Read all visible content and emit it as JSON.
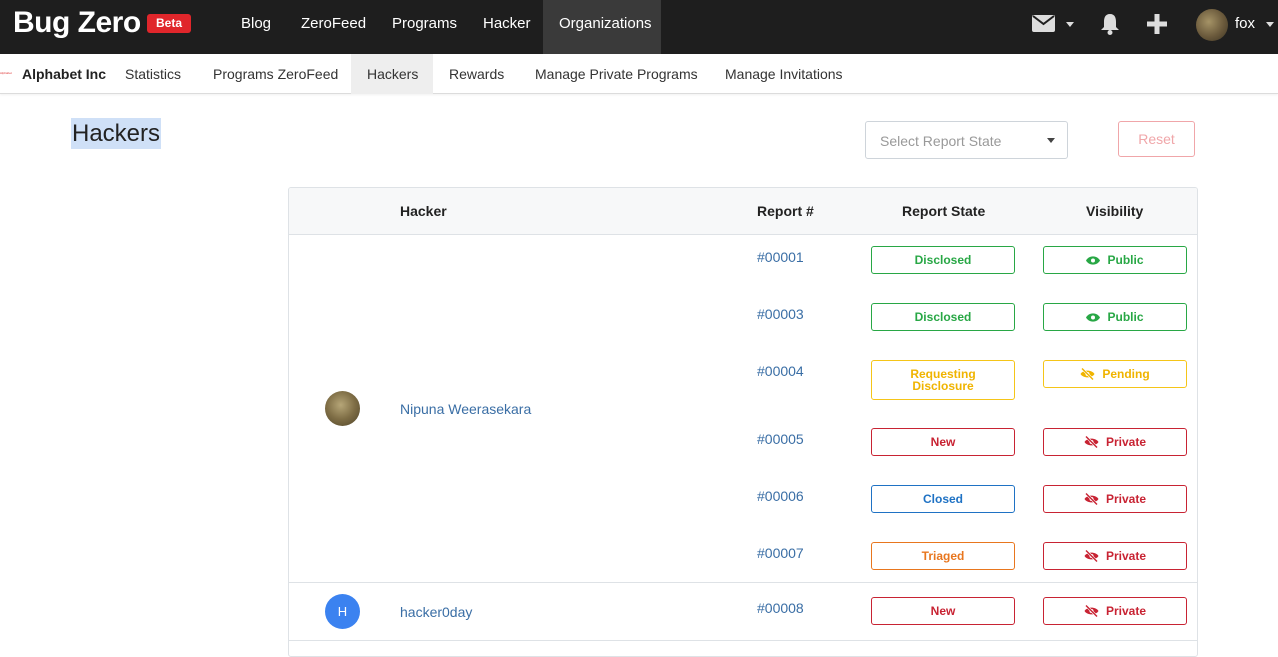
{
  "brand": {
    "name": "Bug Zero",
    "badge": "Beta"
  },
  "topnav": {
    "items": [
      "Blog",
      "ZeroFeed",
      "Programs",
      "Hacker",
      "Organizations"
    ],
    "active": "Organizations",
    "user": "fox"
  },
  "org": {
    "logo_text": "Alphabet",
    "name": "Alphabet Inc",
    "tabs": [
      "Statistics",
      "Programs ZeroFeed",
      "Hackers",
      "Rewards",
      "Manage Private Programs",
      "Manage Invitations"
    ],
    "active_tab": "Hackers"
  },
  "page": {
    "title": "Hackers",
    "filter_placeholder": "Select Report State",
    "reset_label": "Reset"
  },
  "table": {
    "headers": {
      "hacker": "Hacker",
      "report": "Report #",
      "state": "Report State",
      "visibility": "Visibility"
    },
    "groups": [
      {
        "hacker": "Nipuna Weerasekara",
        "avatar": "photo",
        "reports": [
          {
            "id": "#00001",
            "state": "Disclosed",
            "state_color": "green",
            "visibility": "Public",
            "vis_color": "green",
            "vis_icon": "eye-icon"
          },
          {
            "id": "#00003",
            "state": "Disclosed",
            "state_color": "green",
            "visibility": "Public",
            "vis_color": "green",
            "vis_icon": "eye-icon"
          },
          {
            "id": "#00004",
            "state": "Requesting Disclosure",
            "state_color": "yellow",
            "visibility": "Pending",
            "vis_color": "yellow",
            "vis_icon": "eye-slash-icon"
          },
          {
            "id": "#00005",
            "state": "New",
            "state_color": "red",
            "visibility": "Private",
            "vis_color": "red",
            "vis_icon": "eye-slash-icon"
          },
          {
            "id": "#00006",
            "state": "Closed",
            "state_color": "blue",
            "visibility": "Private",
            "vis_color": "red",
            "vis_icon": "eye-slash-icon"
          },
          {
            "id": "#00007",
            "state": "Triaged",
            "state_color": "orange",
            "visibility": "Private",
            "vis_color": "red",
            "vis_icon": "eye-slash-icon"
          }
        ]
      },
      {
        "hacker": "hacker0day",
        "avatar": "H",
        "reports": [
          {
            "id": "#00008",
            "state": "New",
            "state_color": "red",
            "visibility": "Private",
            "vis_color": "red",
            "vis_icon": "eye-slash-icon"
          }
        ]
      }
    ]
  },
  "colors": {
    "navbar": "#1e1e1e",
    "beta": "#e0262b",
    "link": "#3a6ea5",
    "green": "#28a745",
    "yellow": "#f0b400",
    "red": "#c82333",
    "blue": "#1f72c4",
    "orange": "#e8761e"
  }
}
